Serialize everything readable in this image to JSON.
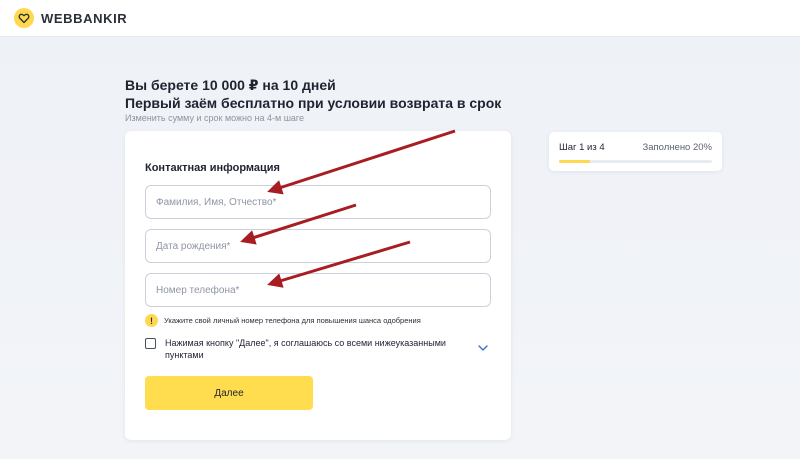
{
  "brand": {
    "name": "WEBBANKIR",
    "logo_icon": "heart-badge-icon",
    "accent_color": "#ffd84d"
  },
  "offer": {
    "line1": "Вы берете 10 000 ₽ на 10 дней",
    "line2": "Первый заём бесплатно при условии возврата в срок",
    "hint": "Изменить сумму и срок можно на 4-м шаге"
  },
  "form": {
    "section_title": "Контактная информация",
    "full_name_placeholder": "Фамилия, Имя, Отчество*",
    "full_name_value": "",
    "birth_date_placeholder": "Дата рождения*",
    "birth_date_value": "",
    "phone_placeholder": "Номер телефона*",
    "phone_value": "",
    "phone_notice": "Укажите свой личный номер телефона для повышения шанса одобрения",
    "notice_icon": "exclamation-icon",
    "agreement_text": "Нажимая кнопку \"Далее\", я соглашаюсь со всеми нижеуказанными пунктами",
    "agreement_checked": false,
    "next_label": "Далее"
  },
  "progress": {
    "step_text": "Шаг 1 из 4",
    "filled_text": "Заполнено 20%",
    "filled_fraction": 0.2
  },
  "annotations": {
    "arrow_color": "#a81d22"
  }
}
